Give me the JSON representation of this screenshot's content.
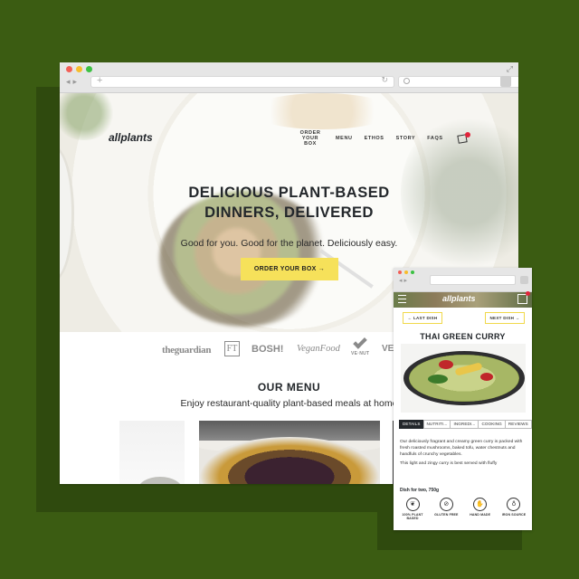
{
  "desktop": {
    "logo": "allplants",
    "nav": {
      "order_line1": "ORDER",
      "order_line2": "YOUR BOX",
      "menu": "MENU",
      "ethos": "ETHOS",
      "story": "STORY",
      "faqs": "FAQS"
    },
    "hero": {
      "headline_line1": "DELICIOUS PLANT-BASED",
      "headline_line2": "DINNERS, DELIVERED",
      "subline": "Good for you. Good for the planet. Deliciously easy.",
      "cta": "ORDER YOUR BOX →"
    },
    "press": {
      "guardian": "theguardian",
      "ft": "FT",
      "bosh": "BOSH!",
      "veganfood": "VeganFood",
      "vnutrition": "VE·NUT",
      "vega": "VEGA"
    },
    "menu_section": {
      "title": "OUR MENU",
      "subtitle": "Enjoy restaurant-quality plant-based meals at home"
    }
  },
  "mobile": {
    "logo": "allplants",
    "prev_button": "← LAST DISH",
    "next_button": "NEXT DISH →",
    "dish_title": "THAI GREEN CURRY",
    "tabs": [
      "DETAILS",
      "NUTRITI...",
      "INGREDI...",
      "COOKING",
      "REVIEWS"
    ],
    "description": [
      "Our deliciously fragrant and creamy green curry is packed with fresh roasted mushrooms, baked tofu, water chestnuts and handfuls of crunchy vegetables.",
      "This light and zingy curry is best served with fluffy"
    ],
    "serving": "Dish for two, 750g",
    "badges": [
      {
        "label": "100% PLANT BASED",
        "icon": "leaf-icon"
      },
      {
        "label": "GLUTEN FREE",
        "icon": "wheat-icon"
      },
      {
        "label": "HAND MADE",
        "icon": "hand-icon"
      },
      {
        "label": "IRON SOURCE",
        "icon": "drop-icon"
      }
    ]
  },
  "colors": {
    "background": "#3b5c12",
    "cta": "#f6e15a",
    "badge_red": "#e2233a",
    "text_dark": "#23272b"
  }
}
